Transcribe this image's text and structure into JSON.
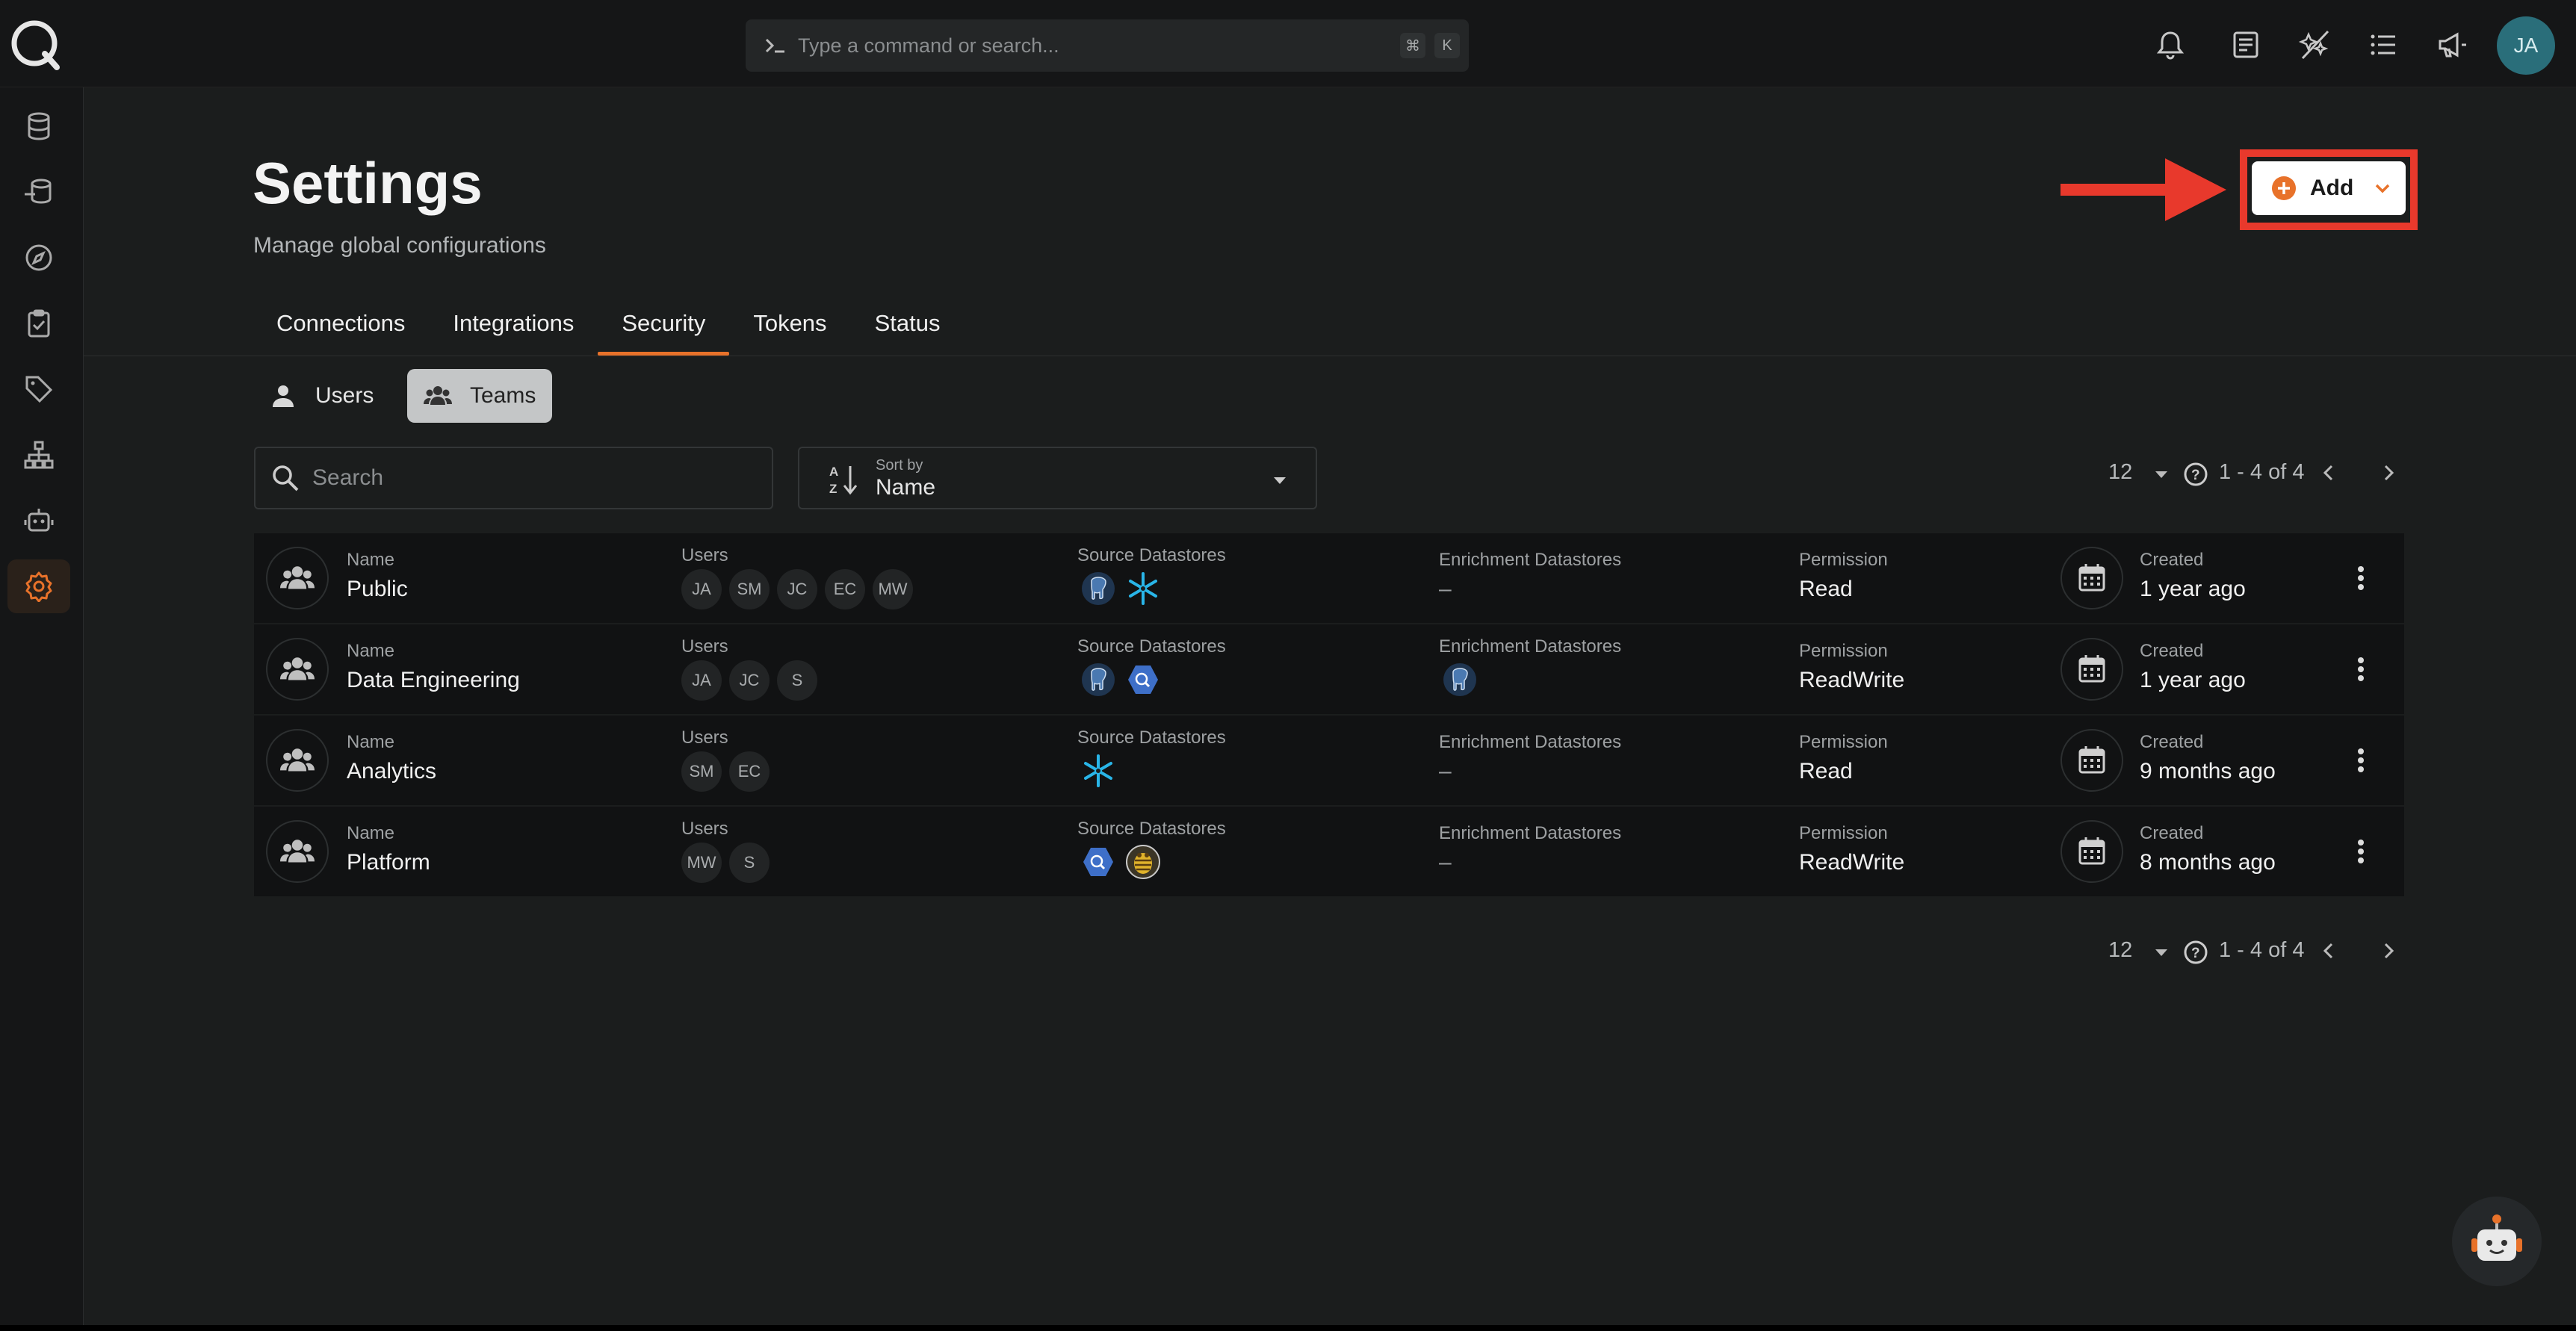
{
  "topbar": {
    "command_placeholder": "Type a command or search...",
    "shortcut_key1": "⌘",
    "shortcut_key2": "K",
    "avatar_initials": "JA"
  },
  "page": {
    "title": "Settings",
    "subtitle": "Manage global configurations",
    "add_label": "Add"
  },
  "tabs": [
    "Connections",
    "Integrations",
    "Security",
    "Tokens",
    "Status"
  ],
  "active_tab": "Security",
  "toggles": {
    "users": "Users",
    "teams": "Teams"
  },
  "search": {
    "placeholder": "Search"
  },
  "sort": {
    "label": "Sort by",
    "value": "Name"
  },
  "pager": {
    "per_page": "12",
    "range": "1 - 4 of 4"
  },
  "columns": {
    "name": "Name",
    "users": "Users",
    "source": "Source Datastores",
    "enrichment": "Enrichment Datastores",
    "permission": "Permission",
    "created": "Created"
  },
  "rows": [
    {
      "name": "Public",
      "users": [
        "JA",
        "SM",
        "JC",
        "EC",
        "MW"
      ],
      "source": [
        "postgres",
        "snowflake"
      ],
      "enrichment": "–",
      "permission": "Read",
      "created": "1 year ago"
    },
    {
      "name": "Data Engineering",
      "users": [
        "JA",
        "JC",
        "S"
      ],
      "source": [
        "postgres",
        "bigquery"
      ],
      "enrichment": "postgres",
      "permission": "ReadWrite",
      "created": "1 year ago"
    },
    {
      "name": "Analytics",
      "users": [
        "SM",
        "EC"
      ],
      "source": [
        "snowflake"
      ],
      "enrichment": "–",
      "permission": "Read",
      "created": "9 months ago"
    },
    {
      "name": "Platform",
      "users": [
        "MW",
        "S"
      ],
      "source": [
        "bigquery",
        "hive"
      ],
      "enrichment": "–",
      "permission": "ReadWrite",
      "created": "8 months ago"
    }
  ],
  "colors": {
    "accent": "#e8722a",
    "highlight": "#e8392c",
    "background": "#1b1d1d"
  }
}
